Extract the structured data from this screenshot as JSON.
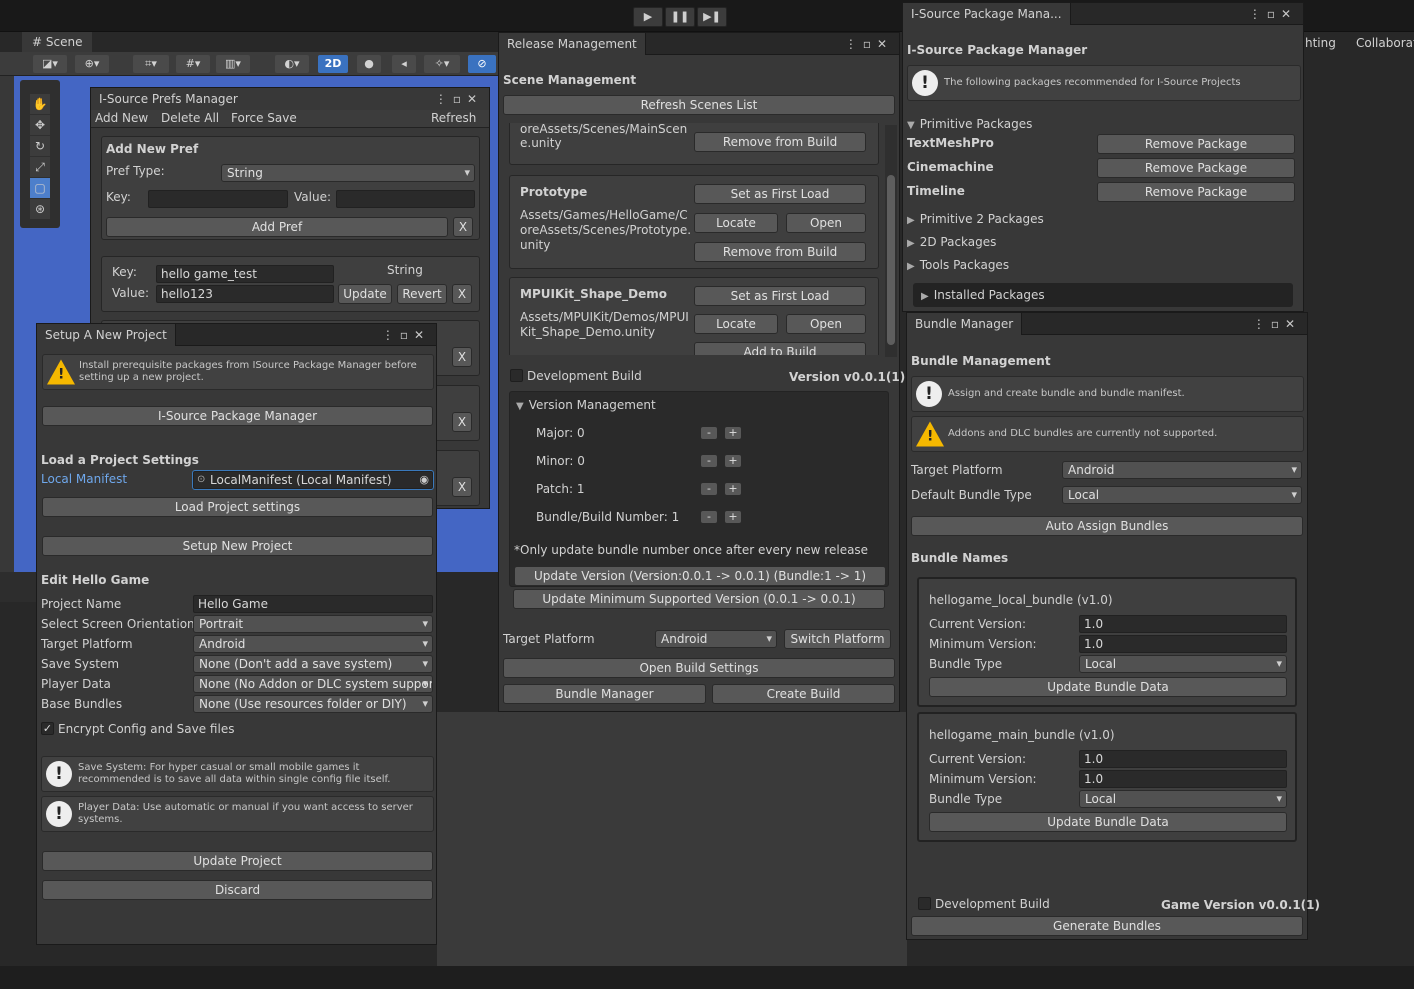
{
  "toolbar": {
    "play": "▶",
    "pause": "❚❚",
    "step": "▶❚"
  },
  "scene": {
    "tab": "Scene",
    "mode_2d": "2D",
    "right_tabs": [
      "hting",
      "Collaborat"
    ]
  },
  "prefs": {
    "title": "I-Source Prefs Manager",
    "menu": [
      "Add New",
      "Delete All",
      "Force Save",
      "Refresh"
    ],
    "add_header": "Add New Pref",
    "pref_type_label": "Pref Type:",
    "pref_type": "String",
    "key_label": "Key:",
    "value_label": "Value:",
    "add_btn": "Add Pref",
    "x": "X",
    "entry": {
      "key_label": "Key:",
      "key": "hello game_test",
      "type": "String",
      "value_label": "Value:",
      "value": "hello123",
      "update": "Update",
      "revert": "Revert",
      "x": "X"
    }
  },
  "setup": {
    "title": "Setup A New Project",
    "warn": "Install prerequisite packages from ISource Package Manager before setting up a new project.",
    "pkg_btn": "I-Source Package Manager",
    "load_header": "Load a Project Settings",
    "local_manifest_label": "Local Manifest",
    "local_manifest_value": "LocalManifest (Local Manifest)",
    "load_btn": "Load Project settings",
    "setup_btn": "Setup New Project",
    "edit_header": "Edit Hello Game",
    "fields": [
      {
        "label": "Project Name",
        "value": "Hello Game"
      },
      {
        "label": "Select Screen Orientation",
        "value": "Portrait"
      },
      {
        "label": "Target Platform",
        "value": "Android"
      },
      {
        "label": "Save System",
        "value": "None (Don't add a save system)"
      },
      {
        "label": "Player Data",
        "value": "None (No Addon or DLC system support"
      },
      {
        "label": "Base Bundles",
        "value": "None (Use resources folder or DIY)"
      }
    ],
    "encrypt": "Encrypt Config and Save files",
    "info1": "Save System: For hyper casual or small mobile games it recommended is to save all data within single config file itself.",
    "info2": "Player Data: Use automatic or manual if you want access to server systems.",
    "update_btn": "Update Project",
    "discard_btn": "Discard"
  },
  "release": {
    "title": "Release Management",
    "scene_header": "Scene Management",
    "refresh_btn": "Refresh Scenes List",
    "main_path": "oreAssets/Scenes/MainScen e.unity",
    "remove_btn": "Remove from Build",
    "scenes": [
      {
        "name": "Prototype",
        "path": "Assets/Games/HelloGame/C oreAssets/Scenes/Prototype. unity",
        "first": "Set as First Load",
        "locate": "Locate",
        "open": "Open",
        "remove": "Remove from Build"
      },
      {
        "name": "MPUIKit_Shape_Demo",
        "path": "Assets/MPUIKit/Demos/MPUI Kit_Shape_Demo.unity",
        "first": "Set as First Load",
        "locate": "Locate",
        "open": "Open",
        "add": "Add to Build"
      }
    ],
    "dev_build": "Development Build",
    "version": "Version v0.0.1(1)",
    "vm_header": "Version Management",
    "versions": [
      {
        "label": "Major: 0"
      },
      {
        "label": "Minor: 0"
      },
      {
        "label": "Patch: 1"
      },
      {
        "label": "Bundle/Build Number: 1"
      }
    ],
    "minus": "-",
    "plus": "+",
    "note": "*Only update bundle number once after every new release",
    "update_version": "Update Version (Version:0.0.1 -> 0.0.1) (Bundle:1 -> 1)",
    "update_min": "Update Minimum Supported Version (0.0.1 -> 0.0.1)",
    "target_label": "Target Platform",
    "target": "Android",
    "switch_btn": "Switch Platform",
    "open_build": "Open Build Settings",
    "bundle_mgr": "Bundle Manager",
    "create_build": "Create Build"
  },
  "pkg": {
    "tab": "I-Source Package Mana...",
    "header": "I-Source Package Manager",
    "info": "The following packages recommended for I-Source Projects",
    "primitive": "Primitive Packages",
    "packages": [
      {
        "name": "TextMeshPro",
        "btn": "Remove Package"
      },
      {
        "name": "Cinemachine",
        "btn": "Remove Package"
      },
      {
        "name": "Timeline",
        "btn": "Remove Package"
      }
    ],
    "groups": [
      "Primitive 2 Packages",
      "2D Packages",
      "Tools Packages"
    ],
    "installed": "Installed Packages"
  },
  "bundle": {
    "title": "Bundle Manager",
    "header": "Bundle Management",
    "info": "Assign and create bundle and bundle manifest.",
    "warn": "Addons and DLC bundles are currently not supported.",
    "target_label": "Target Platform",
    "target": "Android",
    "default_label": "Default Bundle Type",
    "default": "Local",
    "auto_btn": "Auto Assign Bundles",
    "names_header": "Bundle Names",
    "bundles": [
      {
        "name": "hellogame_local_bundle (v1.0)",
        "cur_label": "Current Version:",
        "cur": "1.0",
        "min_label": "Minimum Version:",
        "min": "1.0",
        "type_label": "Bundle Type",
        "type": "Local",
        "btn": "Update Bundle Data"
      },
      {
        "name": "hellogame_main_bundle (v1.0)",
        "cur_label": "Current Version:",
        "cur": "1.0",
        "min_label": "Minimum Version:",
        "min": "1.0",
        "type_label": "Bundle Type",
        "type": "Local",
        "btn": "Update Bundle Data"
      }
    ],
    "dev_build": "Development Build",
    "game_version": "Game Version v0.0.1(1)",
    "generate": "Generate Bundles"
  }
}
